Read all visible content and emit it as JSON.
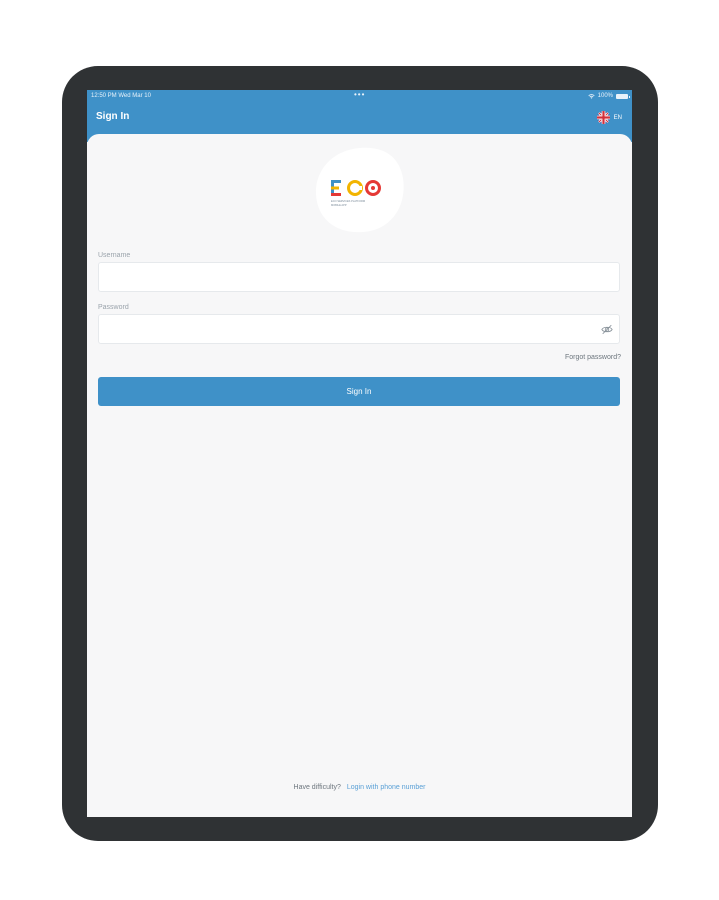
{
  "status_bar": {
    "time_date": "12:50 PM   Wed Mar 10",
    "dots": "•••",
    "battery": "100%"
  },
  "header": {
    "title": "Sign In",
    "language": "EN"
  },
  "logo": {
    "text": "ECO",
    "subtitle_line1": "ECO SERVICES PLATFORM",
    "subtitle_line2": "MOBILE APP"
  },
  "form": {
    "username_label": "Username",
    "username_value": "",
    "password_label": "Password",
    "password_value": "",
    "forgot_password": "Forgot password?",
    "sign_in_button": "Sign In"
  },
  "footer": {
    "question": "Have difficulty?",
    "link": "Login with phone number"
  },
  "colors": {
    "accent": "#3f91c8",
    "link": "#5aa0d6",
    "device": "#2f3234"
  }
}
